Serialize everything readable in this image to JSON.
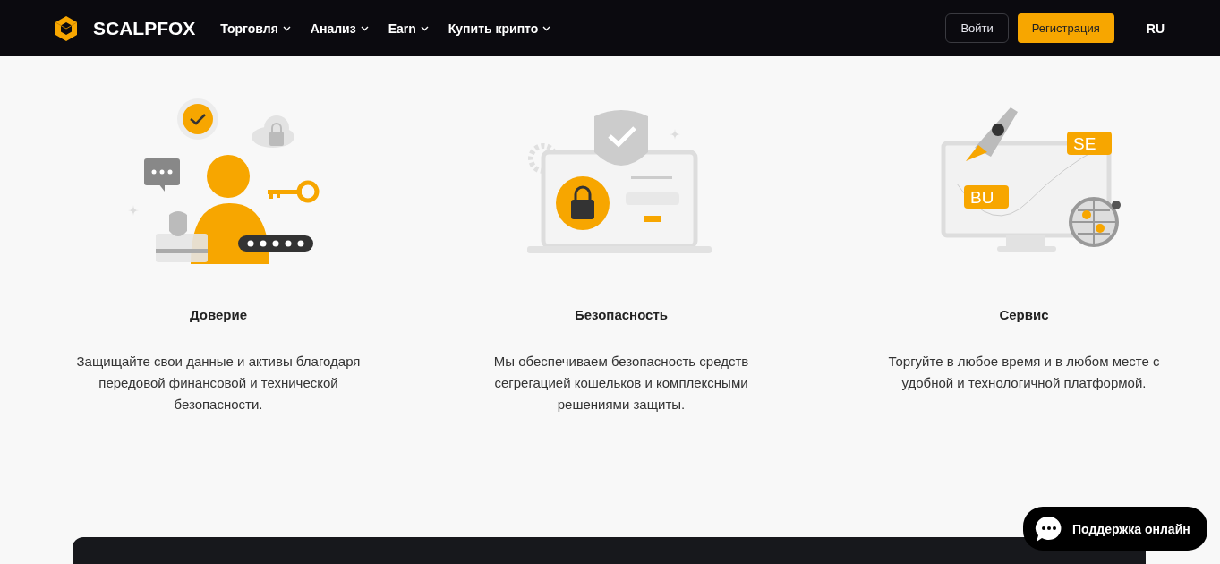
{
  "header": {
    "brand": "SCALPFOX",
    "nav": [
      {
        "label": "Торговля"
      },
      {
        "label": "Анализ"
      },
      {
        "label": "Earn"
      },
      {
        "label": "Купить крипто"
      }
    ],
    "login": "Войти",
    "register": "Регистрация",
    "language": "RU"
  },
  "features": [
    {
      "kind": "trust",
      "title": "Доверие",
      "text": "Защищайте свои данные и активы благодаря передовой финансовой и технической безопасности."
    },
    {
      "kind": "security",
      "title": "Безопасность",
      "text": "Мы обеспечиваем безопасность средств сегрегацией кошельков и комплексными решениями защиты."
    },
    {
      "kind": "service",
      "title": "Сервис",
      "text": "Торгуйте в любое время и в любом месте с удобной и технологичной платформой.",
      "bubbles": [
        "SE",
        "BU"
      ]
    }
  ],
  "support": {
    "label": "Поддержка онлайн"
  }
}
